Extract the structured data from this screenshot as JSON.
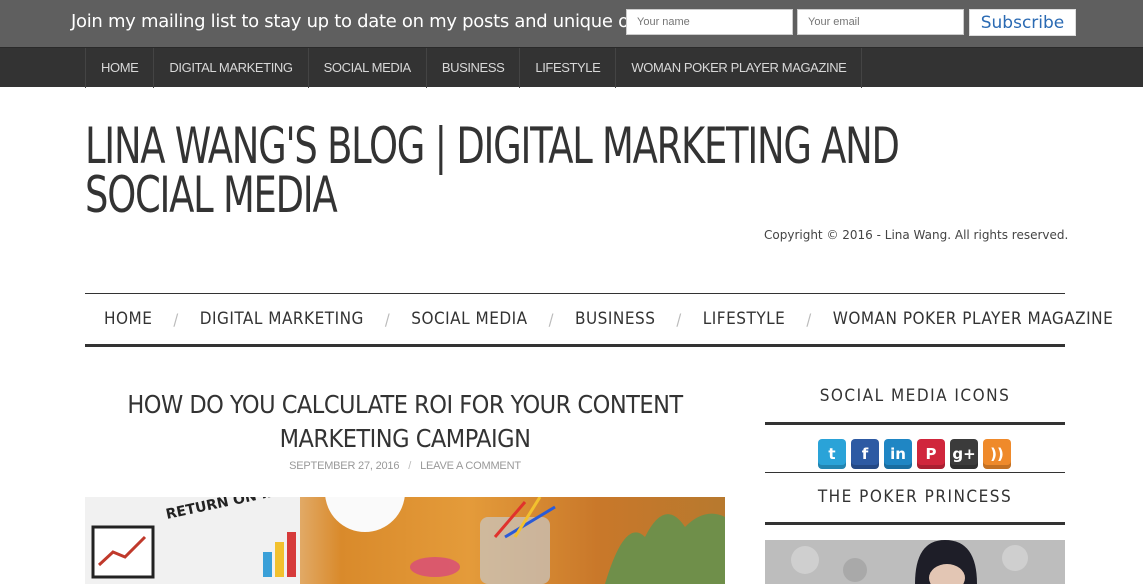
{
  "mailing": {
    "message": "Join my mailing list to stay up to date on my posts and unique offers",
    "name_placeholder": "Your name",
    "email_placeholder": "Your email",
    "subscribe_label": "Subscribe"
  },
  "top_nav": [
    "HOME",
    "DIGITAL MARKETING",
    "SOCIAL MEDIA",
    "BUSINESS",
    "LIFESTYLE",
    "WOMAN POKER PLAYER MAGAZINE"
  ],
  "site": {
    "title": "LINA WANG'S BLOG | DIGITAL MARKETING AND SOCIAL MEDIA",
    "copyright": "Copyright © 2016 - Lina Wang. All rights reserved."
  },
  "main_nav": [
    "HOME",
    "DIGITAL MARKETING",
    "SOCIAL MEDIA",
    "BUSINESS",
    "LIFESTYLE",
    "WOMAN POKER PLAYER MAGAZINE"
  ],
  "nav_separator": "/",
  "post": {
    "title": "HOW DO YOU CALCULATE ROI FOR YOUR CONTENT MARKETING CAMPAIGN",
    "date": "SEPTEMBER 27, 2016",
    "meta_separator": "/",
    "comment_link": "LEAVE A COMMENT",
    "image_text": "RETURN ON INVESTMENT ROI"
  },
  "sidebar": {
    "social_title": "SOCIAL MEDIA ICONS",
    "social_icons": [
      {
        "name": "twitter-icon",
        "glyph": "t",
        "color": "#2aa3d8"
      },
      {
        "name": "facebook-icon",
        "glyph": "f",
        "color": "#2d5aa3"
      },
      {
        "name": "linkedin-icon",
        "glyph": "in",
        "color": "#1f86c4"
      },
      {
        "name": "pinterest-icon",
        "glyph": "P",
        "color": "#d0263c"
      },
      {
        "name": "google-plus-icon",
        "glyph": "g+",
        "color": "#3b3b3b"
      },
      {
        "name": "rss-icon",
        "glyph": "))",
        "color": "#ef8a2b"
      }
    ],
    "poker_title": "THE POKER PRINCESS"
  }
}
